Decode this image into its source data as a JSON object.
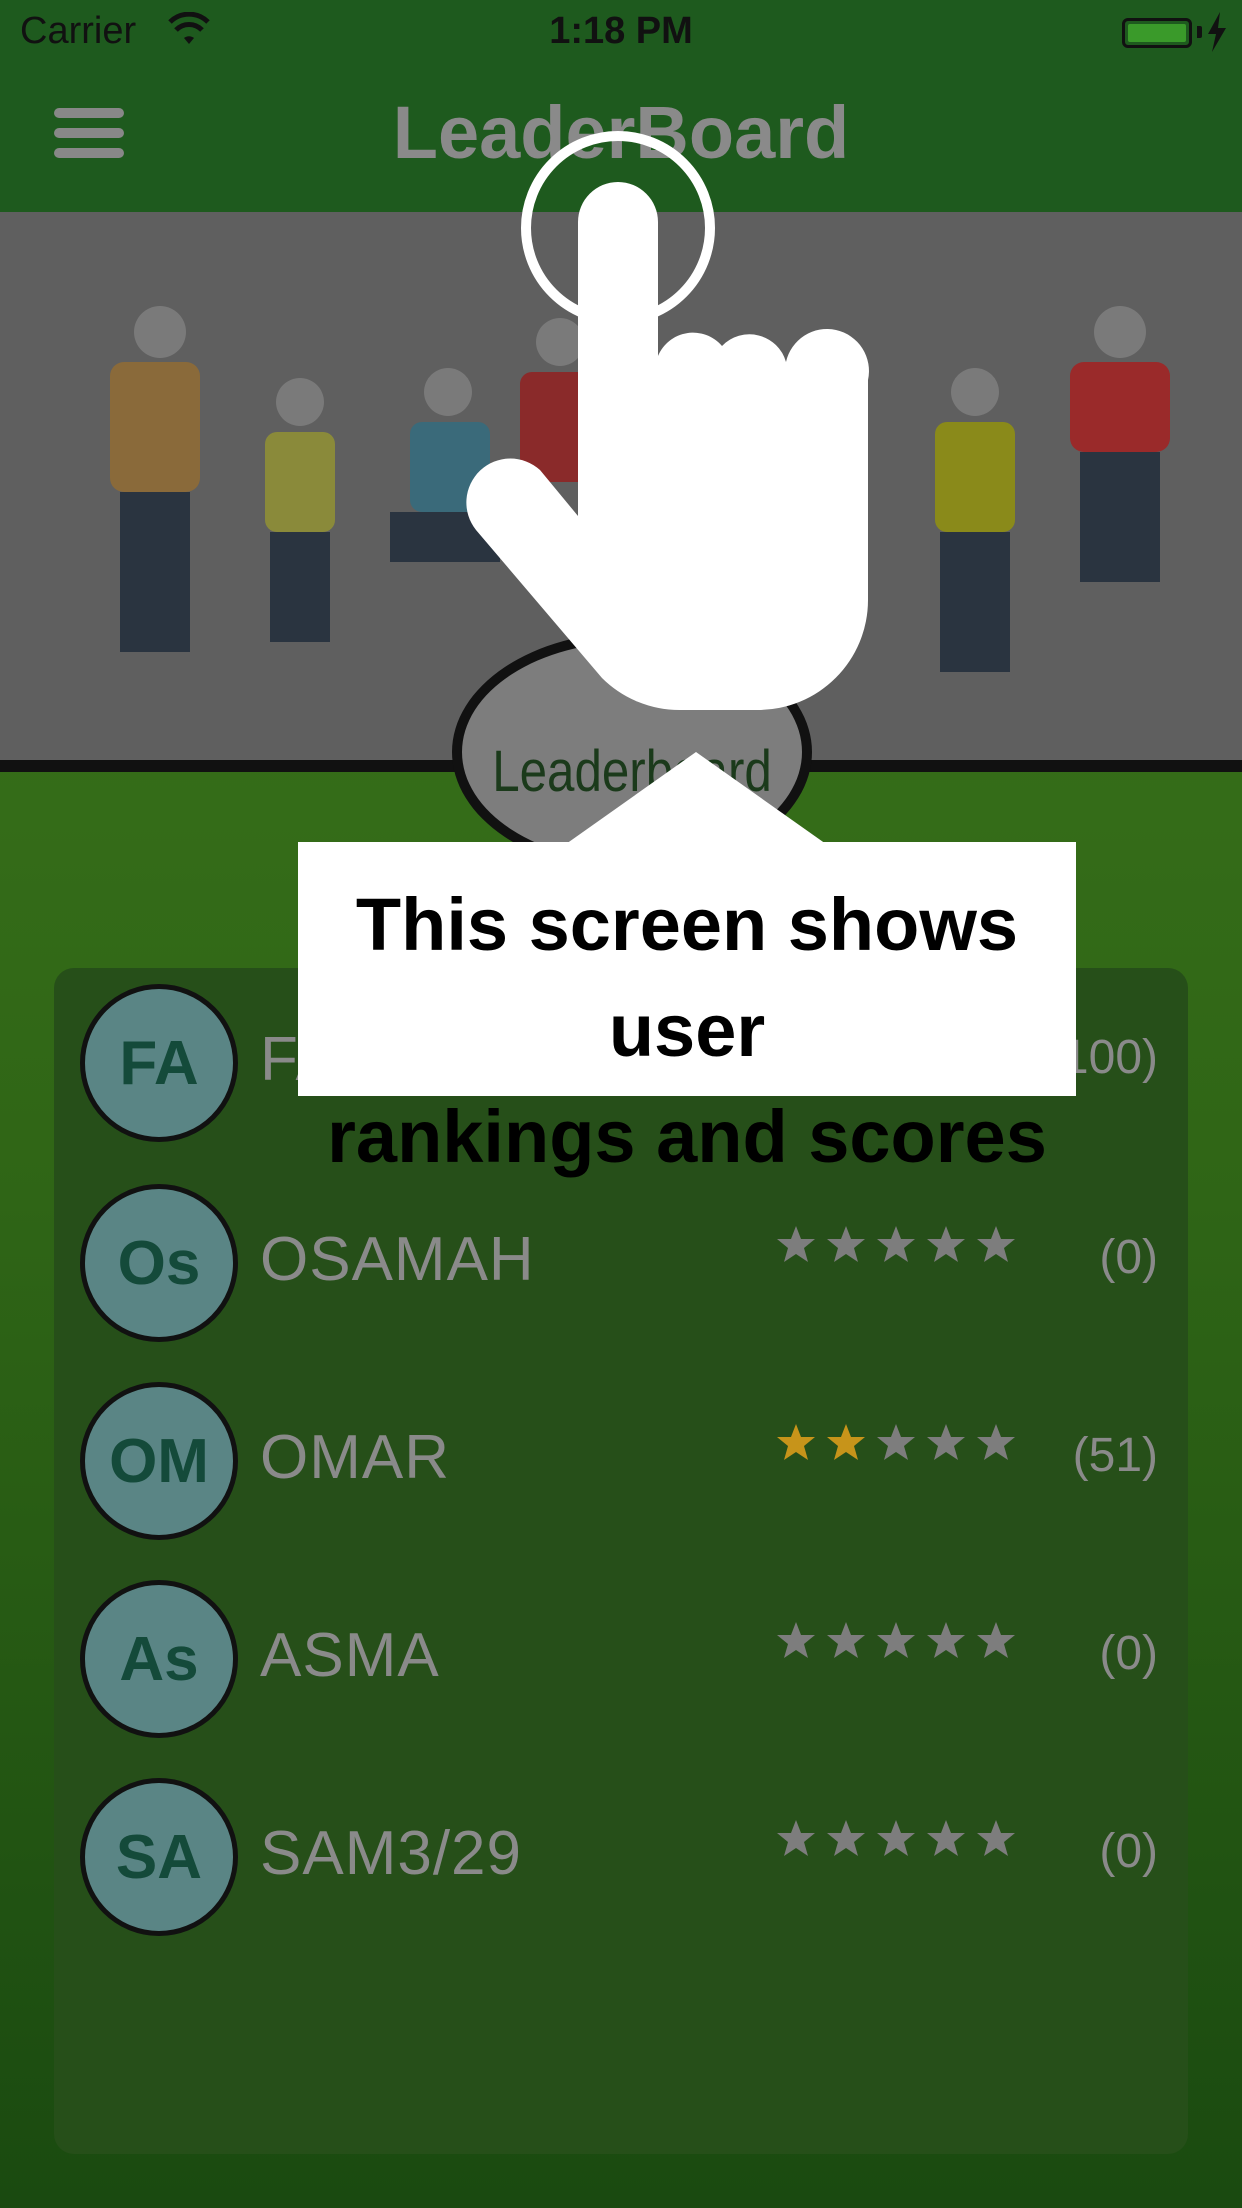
{
  "status_bar": {
    "carrier": "Carrier",
    "time": "1:18 PM"
  },
  "nav": {
    "title": "LeaderBoard"
  },
  "badge": {
    "label": "Leaderboard"
  },
  "callout": {
    "line1": "This screen shows user",
    "line2": "rankings and scores"
  },
  "colors": {
    "star_filled": "#c7941a",
    "star_empty": "#7d7d7d",
    "accent_green": "#1e5a1e"
  },
  "leaderboard": [
    {
      "initials": "FA",
      "name": "FA",
      "score": "(100)",
      "stars": 0
    },
    {
      "initials": "Os",
      "name": "OSAMAH",
      "score": "(0)",
      "stars": 0
    },
    {
      "initials": "OM",
      "name": "OMAR",
      "score": "(51)",
      "stars": 2
    },
    {
      "initials": "As",
      "name": "ASMA",
      "score": "(0)",
      "stars": 0
    },
    {
      "initials": "SA",
      "name": "SAM3/29",
      "score": "(0)",
      "stars": 0
    }
  ]
}
